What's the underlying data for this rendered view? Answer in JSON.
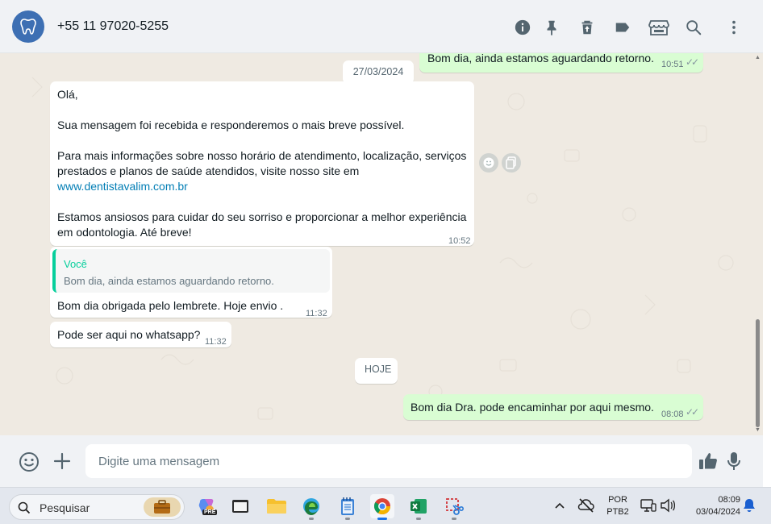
{
  "header": {
    "contact": "+55 11 97020-5255"
  },
  "chat": {
    "dates": {
      "first": "27/03/2024",
      "today": "HOJE"
    },
    "messages": {
      "m1": {
        "text": "Bom dia, ainda estamos aguardando retorno.",
        "time": "10:51"
      },
      "m2": {
        "line1": "Olá,",
        "line2": "Sua mensagem foi recebida e responderemos o mais breve possível.",
        "line3a": "Para mais informações sobre nosso horário de atendimento, localização, serviços",
        "line3b": "prestados e planos de saúde atendidos, visite nosso site em",
        "link": "www.dentistavalim.com.br",
        "line4a": "Estamos ansiosos para cuidar do seu sorriso e proporcionar a melhor experiência",
        "line4b": "em odontologia. Até breve!",
        "time": "10:52"
      },
      "m3": {
        "quote_author": "Você",
        "quote_text": "Bom dia, ainda estamos aguardando retorno.",
        "text": "Bom dia obrigada pelo lembrete. Hoje envio .",
        "time": "11:32"
      },
      "m4": {
        "text": "Pode ser aqui no whatsapp?",
        "time": "11:32"
      },
      "m5": {
        "text": "Bom dia Dra. pode encaminhar por aqui mesmo.",
        "time": "08:08"
      }
    }
  },
  "composer": {
    "placeholder": "Digite uma mensagem"
  },
  "taskbar": {
    "search_label": "Pesquisar",
    "copilot_badge": "PRE",
    "lang": "POR",
    "layout": "PTB2",
    "time": "08:09",
    "date": "03/04/2024"
  },
  "colors": {
    "accent": "#06cf9c",
    "outgoing_bubble": "#d9fdd3",
    "incoming_bubble": "#ffffff",
    "chat_bg": "#efeae2",
    "link": "#027eb5"
  }
}
